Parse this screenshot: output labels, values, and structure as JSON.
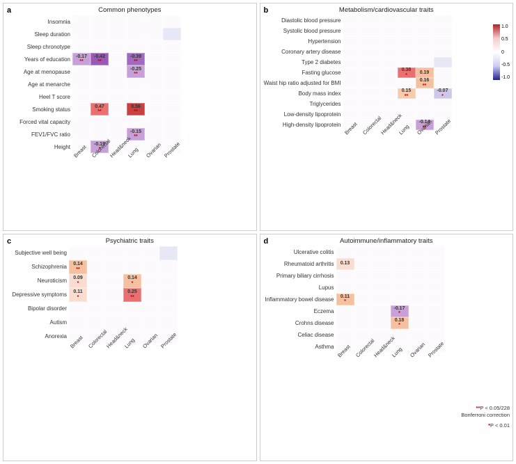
{
  "panels": {
    "a": {
      "label": "a",
      "title": "Common phenotypes",
      "rows": [
        "Insomnia",
        "Sleep duration",
        "Sleep chronotype",
        "Years of education",
        "Age at menopause",
        "Age at menarche",
        "Heel T score",
        "Smoking status",
        "Forced vital capacity",
        "FEV1/FVC ratio",
        "Height"
      ],
      "cols": [
        "Breast",
        "Colorectal",
        "Head&neck",
        "Lung",
        "Ovarian",
        "Prostate"
      ],
      "cells": [
        [
          null,
          null,
          null,
          null,
          null,
          null
        ],
        [
          null,
          null,
          null,
          null,
          null,
          "light-blue"
        ],
        [
          null,
          null,
          null,
          null,
          null,
          null
        ],
        [
          {
            "val": "-0.17",
            "stars": "**",
            "color": "#c8a0d8"
          },
          {
            "val": "-0.42",
            "stars": "**",
            "color": "#9b59b6"
          },
          null,
          {
            "val": "-0.39",
            "stars": "**",
            "color": "#a06abe"
          },
          null,
          null
        ],
        [
          null,
          null,
          null,
          {
            "val": "-0.25",
            "stars": "**",
            "color": "#c8a0d8"
          },
          null,
          null
        ],
        [
          null,
          null,
          null,
          null,
          null,
          null
        ],
        [
          null,
          null,
          null,
          null,
          null,
          null
        ],
        [
          null,
          {
            "val": "0.47",
            "stars": "**",
            "color": "#e87070"
          },
          null,
          {
            "val": "0.56",
            "stars": "**",
            "color": "#c94040"
          },
          null,
          null
        ],
        [
          null,
          null,
          null,
          null,
          null,
          null
        ],
        [
          null,
          null,
          null,
          {
            "val": "-0.15",
            "stars": "**",
            "color": "#c8a0d8"
          },
          null,
          null
        ],
        [
          null,
          {
            "val": "-0.19",
            "stars": "*",
            "color": "#c8a0d8"
          },
          null,
          null,
          null,
          null
        ]
      ]
    },
    "b": {
      "label": "b",
      "title": "Metabolism/cardiovascular traits",
      "rows": [
        "Diastolic blood pressure",
        "Systolic blood pressure",
        "Hypertension",
        "Coronary artery disease",
        "Type 2 diabetes",
        "Fasting glucose",
        "Waist hip ratio adjusted for BMI",
        "Body mass index",
        "Triglycerides",
        "Low-density lipoprotein",
        "High-density lipoprotein"
      ],
      "cols": [
        "Breast",
        "Colorectal",
        "Head&neck",
        "Lung",
        "Ovarian",
        "Prostate"
      ],
      "cells": [
        [
          null,
          null,
          null,
          null,
          null,
          null
        ],
        [
          null,
          null,
          null,
          null,
          null,
          null
        ],
        [
          null,
          null,
          null,
          null,
          null,
          null
        ],
        [
          null,
          null,
          null,
          null,
          null,
          null
        ],
        [
          null,
          null,
          null,
          null,
          null,
          "light-blue"
        ],
        [
          null,
          null,
          null,
          {
            "val": "0.38",
            "stars": "*",
            "color": "#e87070"
          },
          {
            "val": "0.19",
            "stars": "",
            "color": "#f4c0a0"
          },
          null
        ],
        [
          null,
          null,
          null,
          null,
          {
            "val": "0.16",
            "stars": "**",
            "color": "#f4c0a0"
          },
          null
        ],
        [
          null,
          null,
          null,
          {
            "val": "0.15",
            "stars": "**",
            "color": "#f4ccb0"
          },
          null,
          {
            "val": "-0.07",
            "stars": "*",
            "color": "#d0c8e8"
          }
        ],
        [
          null,
          null,
          null,
          null,
          null,
          null
        ],
        [
          null,
          null,
          null,
          null,
          null,
          null
        ],
        [
          null,
          null,
          null,
          null,
          {
            "val": "-0.14",
            "stars": "**",
            "color": "#c8a0d8"
          },
          null
        ]
      ]
    },
    "c": {
      "label": "c",
      "title": "Psychiatric traits",
      "rows": [
        "Subjective well being",
        "Schizophrenia",
        "Neuroticism",
        "Depressive symptoms",
        "Bipolar disorder",
        "Autism",
        "Anorexia"
      ],
      "cols": [
        "Breast",
        "Colorectal",
        "Head&neck",
        "Lung",
        "Ovarian",
        "Prostate"
      ],
      "cells": [
        [
          null,
          null,
          null,
          null,
          null,
          "light-blue"
        ],
        [
          {
            "val": "0.14",
            "stars": "**",
            "color": "#f4c0a0"
          },
          null,
          null,
          null,
          null,
          null
        ],
        [
          {
            "val": "0.09",
            "stars": "*",
            "color": "#f8ddd0"
          },
          null,
          null,
          {
            "val": "0.14",
            "stars": "*",
            "color": "#f4c0a0"
          },
          null,
          null
        ],
        [
          {
            "val": "0.11",
            "stars": "*",
            "color": "#f8ddd0"
          },
          null,
          null,
          {
            "val": "0.25",
            "stars": "**",
            "color": "#e87070"
          },
          null,
          null
        ],
        [
          null,
          null,
          null,
          null,
          null,
          null
        ],
        [
          null,
          null,
          null,
          null,
          null,
          null
        ],
        [
          null,
          null,
          null,
          null,
          null,
          null
        ]
      ]
    },
    "d": {
      "label": "d",
      "title": "Autoimmune/inflammatory traits",
      "rows": [
        "Ulcerative colitis",
        "Rheumatoid arthritis",
        "Primary biliary cirrhosis",
        "Lupus",
        "Inflammatory bowel disease",
        "Eczema",
        "Crohns disease",
        "Celiac disease",
        "Asthma"
      ],
      "cols": [
        "Breast",
        "Colorectal",
        "Head&neck",
        "Lung",
        "Ovarian",
        "Prostate"
      ],
      "cells": [
        [
          null,
          null,
          null,
          null,
          null,
          null
        ],
        [
          {
            "val": "0.13",
            "stars": "",
            "color": "#f8ddd0"
          },
          null,
          null,
          null,
          null,
          null
        ],
        [
          null,
          null,
          null,
          null,
          null,
          null
        ],
        [
          null,
          null,
          null,
          null,
          null,
          null
        ],
        [
          {
            "val": "0.11",
            "stars": "*",
            "color": "#f4c0a0"
          },
          null,
          null,
          null,
          null,
          null
        ],
        [
          null,
          null,
          null,
          {
            "val": "-0.17",
            "stars": "*",
            "color": "#c8a0d8"
          },
          null,
          null
        ],
        [
          null,
          null,
          null,
          {
            "val": "0.18",
            "stars": "*",
            "color": "#f4c0a0"
          },
          null,
          null
        ],
        [
          null,
          null,
          null,
          null,
          null,
          null
        ],
        [
          null,
          null,
          null,
          null,
          null,
          null
        ]
      ]
    }
  },
  "legend": {
    "values": [
      "1.0",
      "0.5",
      "0",
      "-0.5",
      "-1.0"
    ]
  },
  "significance": {
    "double": "**P < 0.05/228",
    "correction": "Bonferroni correction",
    "single": "*P < 0.01"
  }
}
